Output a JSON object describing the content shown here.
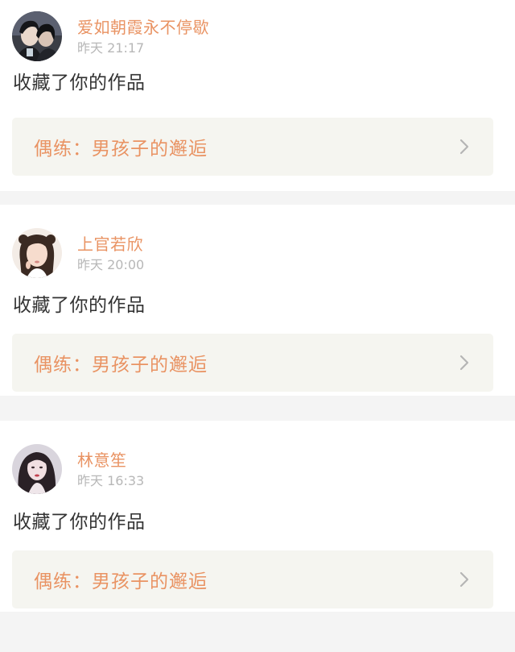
{
  "notifications": [
    {
      "username": "爱如朝霞永不停歇",
      "time": "昨天 21:17",
      "action": "收藏了你的作品",
      "work_title": "偶练：男孩子的邂逅"
    },
    {
      "username": "上官若欣",
      "time": "昨天 20:00",
      "action": "收藏了你的作品",
      "work_title": "偶练：男孩子的邂逅"
    },
    {
      "username": "林意笙",
      "time": "昨天 16:33",
      "action": "收藏了你的作品",
      "work_title": "偶练：男孩子的邂逅"
    }
  ],
  "colors": {
    "accent": "#e99363",
    "card_bg": "#ffffff",
    "divider_bg": "#f4f4f4",
    "link_bg": "#f5f5f0",
    "time_text": "#b7b7b7",
    "body_text": "#333333"
  },
  "icons": {
    "chevron": "chevron-right-icon"
  }
}
